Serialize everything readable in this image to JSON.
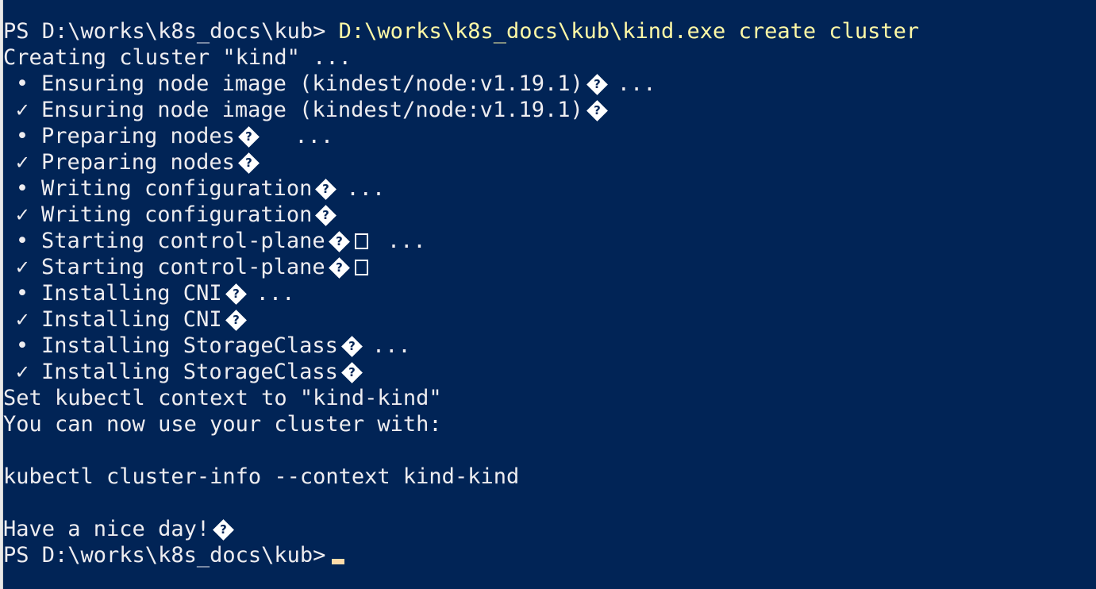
{
  "window": {
    "prompt": "PS D:\\works\\k8s_docs\\kub>",
    "command": "D:\\works\\k8s_docs\\kub\\kind.exe create cluster"
  },
  "output": {
    "creating": "Creating cluster \"kind\" ...",
    "steps": [
      {
        "mark": "•",
        "text": "Ensuring node image (kindest/node:v1.19.1)",
        "box": false,
        "ellipsis": "..."
      },
      {
        "mark": "✓",
        "text": "Ensuring node image (kindest/node:v1.19.1)",
        "box": false,
        "ellipsis": ""
      },
      {
        "mark": "•",
        "text": "Preparing nodes",
        "box": false,
        "ellipsis": "  ..."
      },
      {
        "mark": "✓",
        "text": "Preparing nodes",
        "box": false,
        "ellipsis": ""
      },
      {
        "mark": "•",
        "text": "Writing configuration",
        "box": false,
        "ellipsis": "..."
      },
      {
        "mark": "✓",
        "text": "Writing configuration",
        "box": false,
        "ellipsis": ""
      },
      {
        "mark": "•",
        "text": "Starting control-plane",
        "box": true,
        "ellipsis": " ..."
      },
      {
        "mark": "✓",
        "text": "Starting control-plane",
        "box": true,
        "ellipsis": ""
      },
      {
        "mark": "•",
        "text": "Installing CNI",
        "box": false,
        "ellipsis": "..."
      },
      {
        "mark": "✓",
        "text": "Installing CNI",
        "box": false,
        "ellipsis": ""
      },
      {
        "mark": "•",
        "text": "Installing StorageClass",
        "box": false,
        "ellipsis": "..."
      },
      {
        "mark": "✓",
        "text": "Installing StorageClass",
        "box": false,
        "ellipsis": ""
      }
    ],
    "context": "Set kubectl context to \"kind-kind\"",
    "usage": "You can now use your cluster with:",
    "hint_command": "kubectl cluster-info --context kind-kind",
    "farewell": "Have a nice day!"
  },
  "glyphs": {
    "replacement": "?"
  },
  "colors": {
    "background": "#012456",
    "text": "#eeedf0",
    "command": "#fff9a6",
    "cursor": "#fedba9"
  }
}
